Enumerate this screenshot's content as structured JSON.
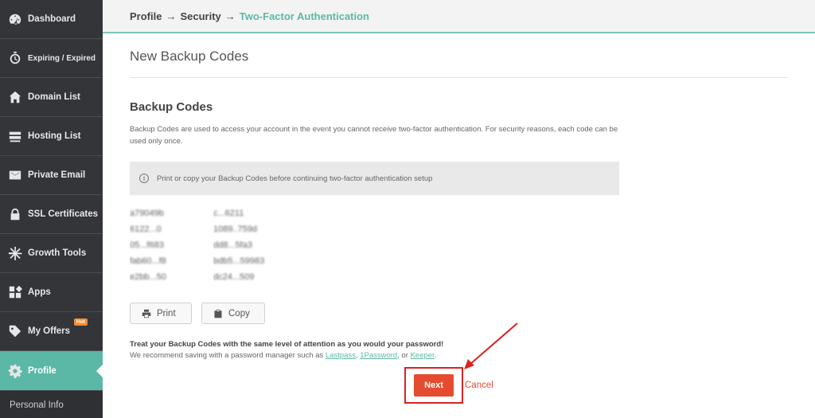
{
  "sidebar": {
    "items": [
      {
        "label": "Dashboard",
        "icon": "dashboard-icon"
      },
      {
        "label": "Expiring / Expired",
        "icon": "stopwatch-icon"
      },
      {
        "label": "Domain List",
        "icon": "home-icon"
      },
      {
        "label": "Hosting List",
        "icon": "server-icon"
      },
      {
        "label": "Private Email",
        "icon": "envelope-icon"
      },
      {
        "label": "SSL Certificates",
        "icon": "lock-icon"
      },
      {
        "label": "Growth Tools",
        "icon": "asterisk-icon"
      },
      {
        "label": "Apps",
        "icon": "apps-icon"
      },
      {
        "label": "My Offers",
        "icon": "tag-icon",
        "badge": "Hot"
      },
      {
        "label": "Profile",
        "icon": "gear-icon",
        "active": true
      }
    ],
    "sub_item": "Personal Info"
  },
  "breadcrumb": {
    "items": [
      "Profile",
      "Security",
      "Two-Factor Authentication"
    ],
    "separator": "→"
  },
  "page": {
    "title": "New Backup Codes",
    "section_title": "Backup Codes",
    "description": "Backup Codes are used to access your account in the event you cannot receive two-factor authentication. For security reasons, each code can be used only once.",
    "notice": "Print or copy your Backup Codes before continuing two-factor authentication setup",
    "codes": [
      [
        "a79049b",
        "c...6211"
      ],
      [
        "6122...0",
        "1089..759d"
      ],
      [
        "05...f683",
        "dd8...5fa3"
      ],
      [
        "fab60...f8",
        "bdb5...59983"
      ],
      [
        "e2bb...50",
        "dc24...509"
      ]
    ],
    "print_label": "Print",
    "copy_label": "Copy",
    "warning": "Treat your Backup Codes with the same level of attention as you would your password!",
    "recommend_prefix": "We recommend saving with a password manager such as ",
    "managers": [
      "Lastpass",
      "1Password",
      "Keeper"
    ],
    "sep_comma": ", ",
    "sep_or": ", or ",
    "period": "."
  },
  "actions": {
    "next_label": "Next",
    "cancel_label": "Cancel"
  },
  "colors": {
    "sidebar_bg": "#333538",
    "accent": "#5bb8a6",
    "next_button": "#e54b2e",
    "highlight": "#d92323"
  }
}
